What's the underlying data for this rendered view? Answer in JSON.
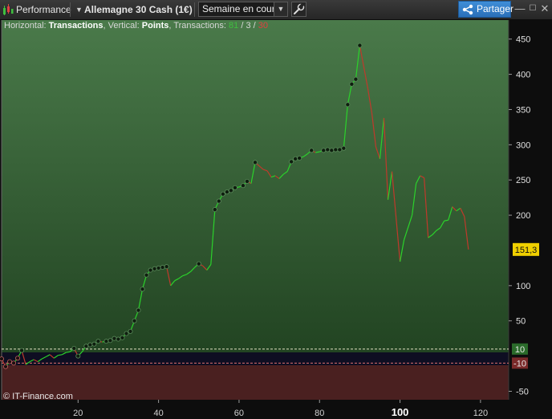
{
  "toolbar": {
    "title": "Performance",
    "instrument": "Allemagne 30 Cash (1€)",
    "period": "Semaine en cours",
    "share_label": "Partager"
  },
  "info": {
    "h_prefix": "Horizontal: ",
    "h_value": "Transactions",
    "v_prefix": ", Vertical: ",
    "v_value": "Points",
    "t_prefix": ", Transactions: ",
    "wins": "81",
    "sep1": " / ",
    "neutral": "3",
    "sep2": " / ",
    "losses": "30"
  },
  "copyright": "© IT-Finance.com",
  "colors": {
    "background_top": "#4a7a4a",
    "background_bottom": "#1a3a1a",
    "loss_zone": "#4a2020",
    "gain_line": "#2bd22b",
    "loss_line": "#c0392b",
    "last_badge": "#f0d000",
    "level_10": "#2a6a2a",
    "level_minus10": "#7a2a2a"
  },
  "chart_data": {
    "type": "line",
    "xlabel": "",
    "ylabel": "",
    "xlim": [
      1,
      127
    ],
    "ylim": [
      -62,
      477
    ],
    "x_ticks": [
      "20",
      "40",
      "60",
      "80",
      "100",
      "120"
    ],
    "x_tick_values": [
      20,
      40,
      60,
      80,
      100,
      120
    ],
    "y_ticks": [
      "450",
      "400",
      "350",
      "300",
      "250",
      "200",
      "100",
      "50",
      "-50"
    ],
    "y_tick_values": [
      450,
      400,
      350,
      300,
      250,
      200,
      100,
      50,
      -50
    ],
    "levels": [
      {
        "label": "10",
        "value": 10
      },
      {
        "label": "-10",
        "value": -10
      }
    ],
    "last_value_label": "151,3",
    "last_value": 151.3,
    "series": [
      {
        "values": [
          [
            1,
            -4
          ],
          [
            2,
            -15
          ],
          [
            3,
            -8
          ],
          [
            4,
            -10
          ],
          [
            5,
            -3
          ],
          [
            6,
            8
          ],
          [
            7,
            -12
          ],
          [
            8,
            -8
          ],
          [
            9,
            -5
          ],
          [
            10,
            -8
          ],
          [
            11,
            -4
          ],
          [
            12,
            -1
          ],
          [
            13,
            2
          ],
          [
            14,
            -3
          ],
          [
            15,
            1
          ],
          [
            16,
            2
          ],
          [
            17,
            5
          ],
          [
            18,
            6
          ],
          [
            19,
            11
          ],
          [
            20,
            0
          ],
          [
            21,
            6
          ],
          [
            22,
            14
          ],
          [
            23,
            16
          ],
          [
            24,
            17
          ],
          [
            25,
            21
          ],
          [
            26,
            20
          ],
          [
            27,
            21
          ],
          [
            28,
            22
          ],
          [
            29,
            25
          ],
          [
            30,
            24
          ],
          [
            31,
            26
          ],
          [
            32,
            32
          ],
          [
            33,
            35
          ],
          [
            34,
            50
          ],
          [
            35,
            65
          ],
          [
            36,
            95
          ],
          [
            37,
            115
          ],
          [
            38,
            122
          ],
          [
            39,
            124
          ],
          [
            40,
            125
          ],
          [
            41,
            126
          ],
          [
            42,
            127
          ],
          [
            43,
            100
          ],
          [
            44,
            107
          ],
          [
            45,
            110
          ],
          [
            46,
            114
          ],
          [
            47,
            116
          ],
          [
            48,
            120
          ],
          [
            49,
            126
          ],
          [
            50,
            131
          ],
          [
            51,
            128
          ],
          [
            52,
            122
          ],
          [
            53,
            130
          ],
          [
            54,
            208
          ],
          [
            55,
            220
          ],
          [
            56,
            230
          ],
          [
            57,
            233
          ],
          [
            58,
            235
          ],
          [
            59,
            239
          ],
          [
            60,
            240
          ],
          [
            61,
            242
          ],
          [
            62,
            248
          ],
          [
            63,
            245
          ],
          [
            64,
            275
          ],
          [
            65,
            270
          ],
          [
            66,
            265
          ],
          [
            67,
            263
          ],
          [
            68,
            254
          ],
          [
            69,
            256
          ],
          [
            70,
            252
          ],
          [
            71,
            258
          ],
          [
            72,
            262
          ],
          [
            73,
            276
          ],
          [
            74,
            280
          ],
          [
            75,
            281
          ],
          [
            76,
            283
          ],
          [
            77,
            287
          ],
          [
            78,
            292
          ],
          [
            79,
            289
          ],
          [
            80,
            290
          ],
          [
            81,
            292
          ],
          [
            82,
            293
          ],
          [
            83,
            292
          ],
          [
            84,
            293
          ],
          [
            85,
            293
          ],
          [
            86,
            295
          ],
          [
            87,
            357
          ],
          [
            88,
            386
          ],
          [
            89,
            393
          ],
          [
            90,
            441
          ],
          [
            92,
            380
          ],
          [
            93,
            345
          ],
          [
            94,
            297
          ],
          [
            95,
            280
          ],
          [
            96,
            338
          ],
          [
            97,
            222
          ],
          [
            98,
            262
          ],
          [
            100,
            134
          ],
          [
            101,
            165
          ],
          [
            103,
            200
          ],
          [
            104,
            245
          ],
          [
            105,
            256
          ],
          [
            106,
            253
          ],
          [
            107,
            168
          ],
          [
            108,
            172
          ],
          [
            109,
            178
          ],
          [
            110,
            182
          ],
          [
            111,
            192
          ],
          [
            112,
            193
          ],
          [
            113,
            212
          ],
          [
            114,
            206
          ],
          [
            115,
            210
          ],
          [
            116,
            198
          ],
          [
            117,
            151.3
          ]
        ]
      }
    ],
    "marker_x": [
      1,
      2,
      3,
      4,
      5,
      6,
      19,
      20,
      22,
      23,
      24,
      25,
      27,
      28,
      29,
      30,
      31,
      32,
      33,
      34,
      35,
      36,
      37,
      38,
      39,
      40,
      41,
      42,
      50,
      54,
      55,
      56,
      57,
      58,
      59,
      61,
      62,
      64,
      73,
      74,
      75,
      78,
      81,
      82,
      83,
      84,
      85,
      86,
      87,
      88,
      89,
      90
    ]
  }
}
